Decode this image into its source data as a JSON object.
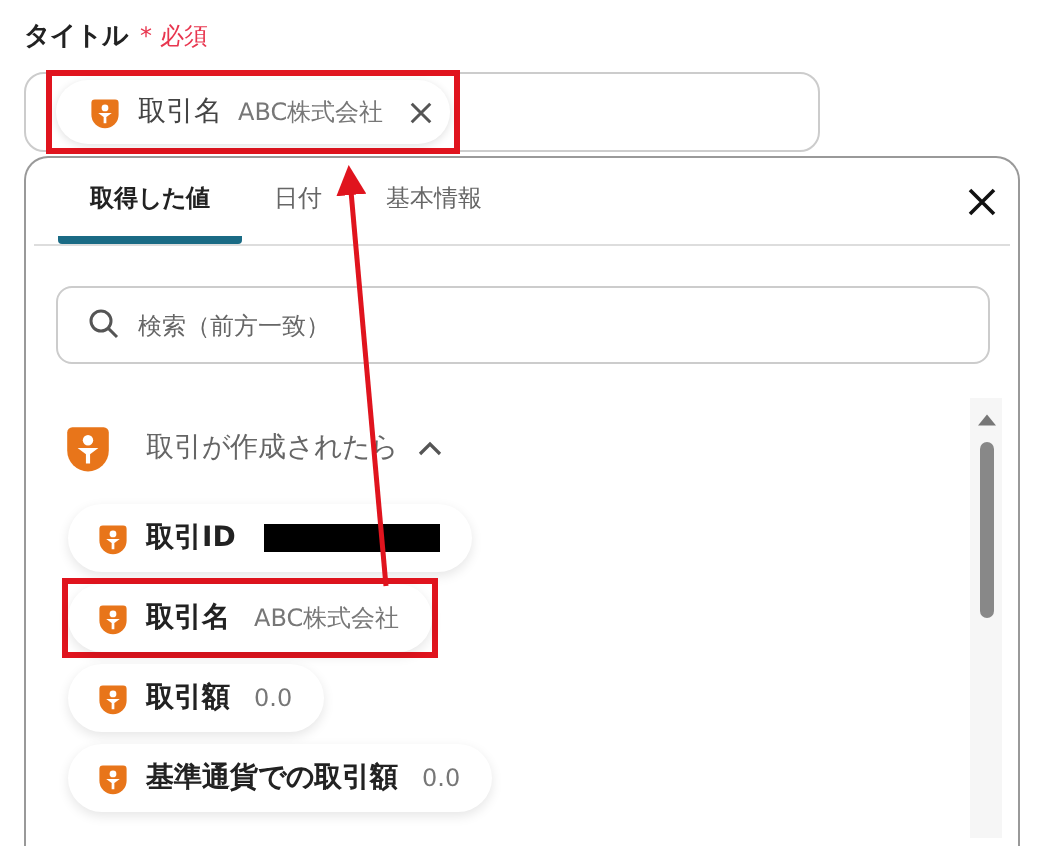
{
  "field": {
    "label": "タイトル",
    "required_label": "* 必須",
    "chip": {
      "name": "取引名",
      "value": "ABC株式会社",
      "highlighted": true
    }
  },
  "popup": {
    "tabs": [
      {
        "label": "取得した値",
        "selected": true
      },
      {
        "label": "日付",
        "selected": false
      },
      {
        "label": "基本情報",
        "selected": false
      }
    ],
    "search": {
      "placeholder": "検索（前方一致）"
    },
    "section": {
      "title": "取引が作成されたら",
      "expanded": true
    },
    "items": [
      {
        "name": "取引ID",
        "value": "",
        "redacted": true,
        "highlighted": false
      },
      {
        "name": "取引名",
        "value": "ABC株式会社",
        "redacted": false,
        "highlighted": true
      },
      {
        "name": "取引額",
        "value": "0.0",
        "redacted": false,
        "highlighted": false
      },
      {
        "name": "基準通貨での取引額",
        "value": "0.0",
        "redacted": false,
        "highlighted": false
      }
    ]
  }
}
